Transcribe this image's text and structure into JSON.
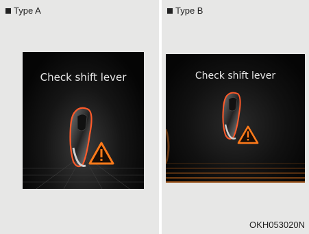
{
  "panels": {
    "type_a": {
      "label": "Type A",
      "message": "Check shift lever"
    },
    "type_b": {
      "label": "Type B",
      "message": "Check shift lever"
    }
  },
  "figure_code": "OKH053020N",
  "icons": [
    "square-bullet-icon",
    "shift-lever-icon",
    "warning-triangle-icon"
  ],
  "colors": {
    "panel_bg": "#e7e7e6",
    "screen_bg": "#050505",
    "warning_orange": "#ff7a1a",
    "grid_orange": "#c86a1e"
  }
}
